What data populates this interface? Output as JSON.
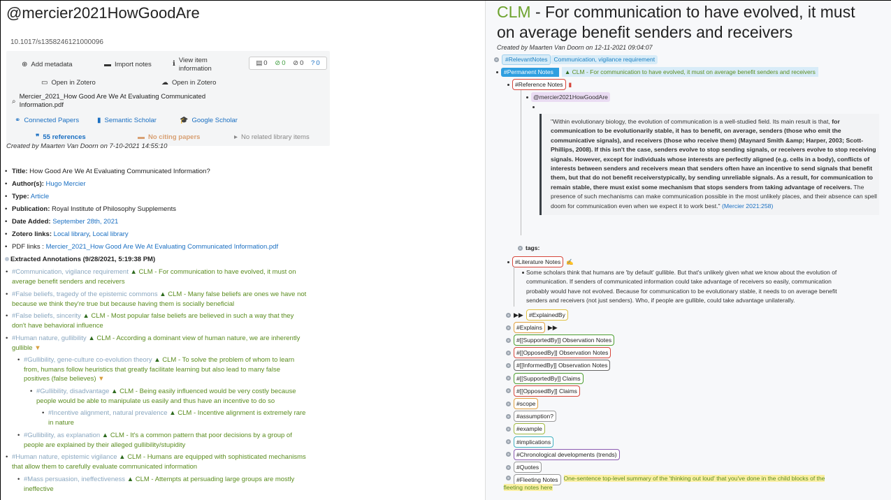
{
  "left": {
    "title": "@mercier2021HowGoodAre",
    "doi": "10.1017/s1358246121000096",
    "actions": {
      "add_metadata": "Add metadata",
      "import_notes": "Import notes",
      "view_item_1": "View item",
      "view_item_2": "information",
      "open_zotero_1": "Open in Zotero",
      "open_zotero_2": "Open in Zotero",
      "pdf_1": "Mercier_2021_How Good Are We At Evaluating Communicated",
      "pdf_2": "Information.pdf",
      "connected_papers": "Connected Papers",
      "semantic_scholar": "Semantic Scholar",
      "google_scholar": "Google Scholar",
      "references": "55 references",
      "citing": "No citing papers",
      "related": "No related library items"
    },
    "counts": {
      "notes": "0",
      "done": "0",
      "blocked": "0",
      "questions": "0"
    },
    "created": "Created by Maarten Van Doorn on 7-10-2021 14:55:10",
    "fields": {
      "title_label": "Title:",
      "title_value": "How Good Are We At Evaluating Communicated Information?",
      "author_label": "Author(s):",
      "author_value": "Hugo Mercier",
      "type_label": "Type:",
      "type_value": "Article",
      "pub_label": "Publication:",
      "pub_value": "Royal Institute of Philosophy Supplements",
      "date_label": "Date Added:",
      "date_value": "September 28th, 2021",
      "zotero_label": "Zotero links:",
      "zotero_value_1": "Local library",
      "zotero_sep": ", ",
      "zotero_value_2": "Local library",
      "pdf_label": "PDF links :",
      "pdf_value": "Mercier_2021_How Good Are We At Evaluating Communicated Information.pdf",
      "extracted": "Extracted Annotations (9/28/2021, 5:19:38 PM)"
    },
    "annotations": [
      {
        "tag": "#Communication, vigilance requirement",
        "text_1": "CLM - For communication to have evolved, it must on",
        "text_2": "average benefit senders and receivers"
      },
      {
        "tag": "#False beliefs, tragedy of the epistemic commons",
        "text_1": "CLM - Many false beliefs are ones we have not",
        "text_2": "because we think they're true but because having them is socially beneficial"
      },
      {
        "tag": "#False beliefs, sincerity",
        "text_1": "CLM - Most popular false beliefs are believed in such a way that they",
        "text_2": "don't have behavioral influence"
      },
      {
        "tag": "#Human nature, gullibility",
        "text_1": "CLM - According a dominant view of human nature, we are inherently",
        "text_2": "gullible"
      },
      {
        "tag": "#Gullibility, gene-culture co-evolution theory",
        "text_1": "CLM - To solve the problem of whom to learn",
        "text_2": "from, humans follow heuristics that greatly facilitate learning but also lead to many false",
        "text_3": "positives (false believes)"
      },
      {
        "tag": "#Gullibility, disadvantage",
        "text_1": "CLM - Being easily influenced would be very costly because",
        "text_2": "people would be able to manipulate us easily and thus have an incentive to do so"
      },
      {
        "tag": "#Incentive alignment, natural prevalence",
        "text_1": "CLM - Incentive alignment is extremely rare",
        "text_2": "in nature"
      },
      {
        "tag": "#Gullibility, as explanation",
        "text_1": "CLM - It's a common pattern that poor decisions by a group of",
        "text_2": "people are explained by their alleged gullibility/stupidity"
      },
      {
        "tag": "#Human nature, epistemic vigilance",
        "text_1": "CLM - Humans are equipped with sophisticated mechanisms",
        "text_2": "that allow them to carefully evaluate communicated information"
      },
      {
        "tag": "#Mass persuasion, ineffectiveness",
        "text_1": "CLM - Attempts at persuading large groups are mostly",
        "text_2": "ineffective"
      }
    ]
  },
  "right": {
    "title_clm": "CLM",
    "title_rest_1": " - For communication to have evolved, it must",
    "title_rest_2": "on average benefit senders and receivers",
    "created": "Created by Maarten Van Doorn on 12-11-2021 09:04:07",
    "relevant_tag": "#RelevantNotes",
    "relevant_value": "Communication, vigilance requirement",
    "permanent_tag": "#Permanent Notes",
    "permanent_value": "CLM - For communication to have evolved, it must on average benefit senders and receivers",
    "reference_tag": "#Reference Notes",
    "mercier_ref": "@mercier2021HowGoodAre",
    "quote": {
      "p1": "\"Within evolutionary biology, the evolution of communication is a well-studied field. Its main result is that,",
      "b1": "for communication to be evolutionarily stable, it has to benefit, on average, senders (those who emit the",
      "b2": "communicative signals), and receivers (those who receive them) (Maynard Smith &amp; Harper, 2003;",
      "b3": "Scott-Phillips, 2008). If this isn't the case, senders evolve to stop sending signals, or receivers evolve to",
      "b4": "stop receiving signals. However, except for individuals whose interests are perfectly aligned (e.g. cells",
      "b5": "in a body), conflicts of interests between senders and receivers mean that senders often have an",
      "b6": "incentive to send signals that benefit them, but that do not benefit receiverstypically, by sending",
      "b7": "unreliable signals. As a result, for communication to remain stable, there must exist some mechanism",
      "b8": "that stops senders from taking advantage of receivers.",
      "p2": " The presence of such mechanisms can make",
      "p3": "communication possible in the most unlikely places, and their absence can spell doom for communication",
      "p4": "even when we expect it to work best.\" ",
      "cite": "(Mercier 2021:258)"
    },
    "tags_label": "tags:",
    "literature_tag": "#Literature Notes",
    "literature_text": [
      "Some scholars think that humans are 'by default' gullible. But that's unlikely given what we know about the evolution of",
      "communication. If senders of communicated information could take advantage of receivers so easily, communication",
      "probably would have not evolved. Because for communication to be evolutionary stable, it needs to on average benefit",
      "senders and receivers (not just senders). Who, if people are gullible, could take advantage unilaterally."
    ],
    "explained_by_prefix": "▶▶",
    "explained_by": "#ExplainedBy",
    "explains": "#Explains",
    "explains_suffix": "▶▶",
    "list": [
      {
        "label": "#[[SupportedBy]] Observation Notes",
        "border": "#4a9d2e"
      },
      {
        "label": "#[[OpposedBy]] Observation Notes",
        "border": "#d6453a"
      },
      {
        "label": "#[[InformedBy]] Observation Notes",
        "border": "#666666"
      },
      {
        "label": "#[[SupportedBy]] Claims",
        "border": "#4a9d2e"
      },
      {
        "label": "#[[OpposedBy]] Claims",
        "border": "#d6453a"
      },
      {
        "label": "#scope",
        "border": "#e0a040"
      },
      {
        "label": "#assumption?",
        "border": "#999999"
      },
      {
        "label": "#example",
        "border": "#a0b840"
      },
      {
        "label": "#implications",
        "border": "#40b0c0"
      },
      {
        "label": "#Chronological developments (trends)",
        "border": "#8a5ab0"
      },
      {
        "label": "#Quotes",
        "border": "#999999"
      }
    ],
    "fleeting_tag": "#Fleeting Notes",
    "fleeting_text_1": "One-sentence top-level summary of the 'thinking out loud' that you've done in the child blocks of the",
    "fleeting_text_2": "fleeting notes here"
  },
  "colors": {
    "accent_green": "#5b8c1f",
    "link_blue": "#1a6fc2",
    "tag_blue": "#2f9fe0"
  }
}
